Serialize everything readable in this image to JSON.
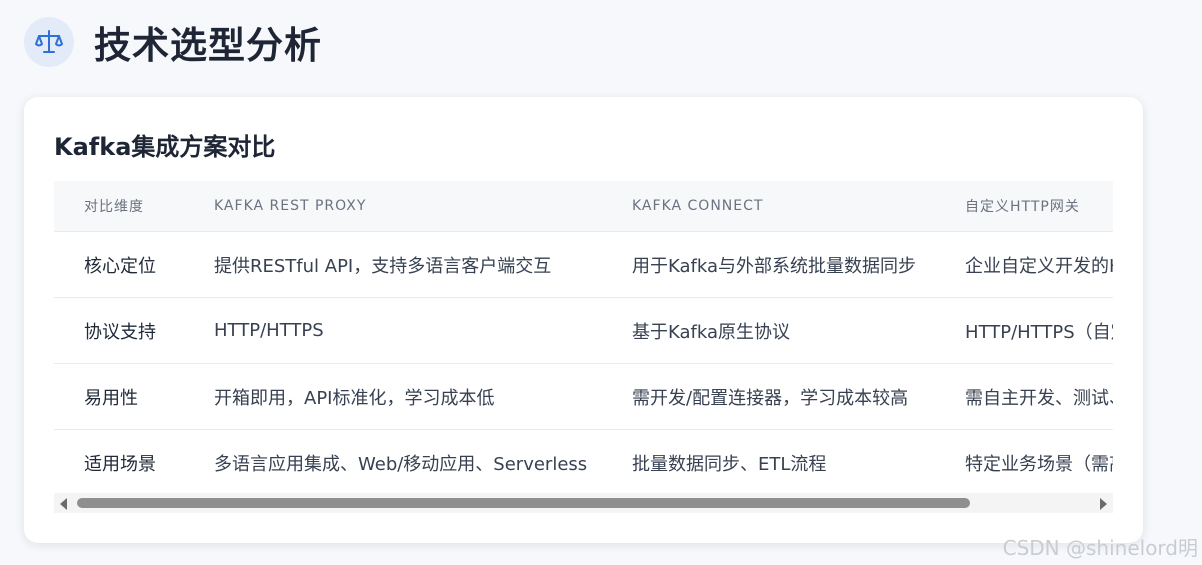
{
  "page": {
    "title": "技术选型分析",
    "icon": "balance-scale-icon"
  },
  "card": {
    "title": "Kafka集成方案对比"
  },
  "table": {
    "headers": [
      "对比维度",
      "KAFKA REST PROXY",
      "KAFKA CONNECT",
      "自定义HTTP网关"
    ],
    "rows": [
      [
        "核心定位",
        "提供RESTful API，支持多语言客户端交互",
        "用于Kafka与外部系统批量数据同步",
        "企业自定义开发的H"
      ],
      [
        "协议支持",
        "HTTP/HTTPS",
        "基于Kafka原生协议",
        "HTTP/HTTPS（自定"
      ],
      [
        "易用性",
        "开箱即用，API标准化，学习成本低",
        "需开发/配置连接器，学习成本较高",
        "需自主开发、测试、"
      ],
      [
        "适用场景",
        "多语言应用集成、Web/移动应用、Serverless",
        "批量数据同步、ETL流程",
        "特定业务场景（需高"
      ]
    ]
  },
  "watermark": "CSDN @shinelord明",
  "colors": {
    "background": "#f6f8fb",
    "icon_bg": "#e3ebf8",
    "icon_stroke": "#2f6fd6",
    "title_text": "#1e2636"
  }
}
